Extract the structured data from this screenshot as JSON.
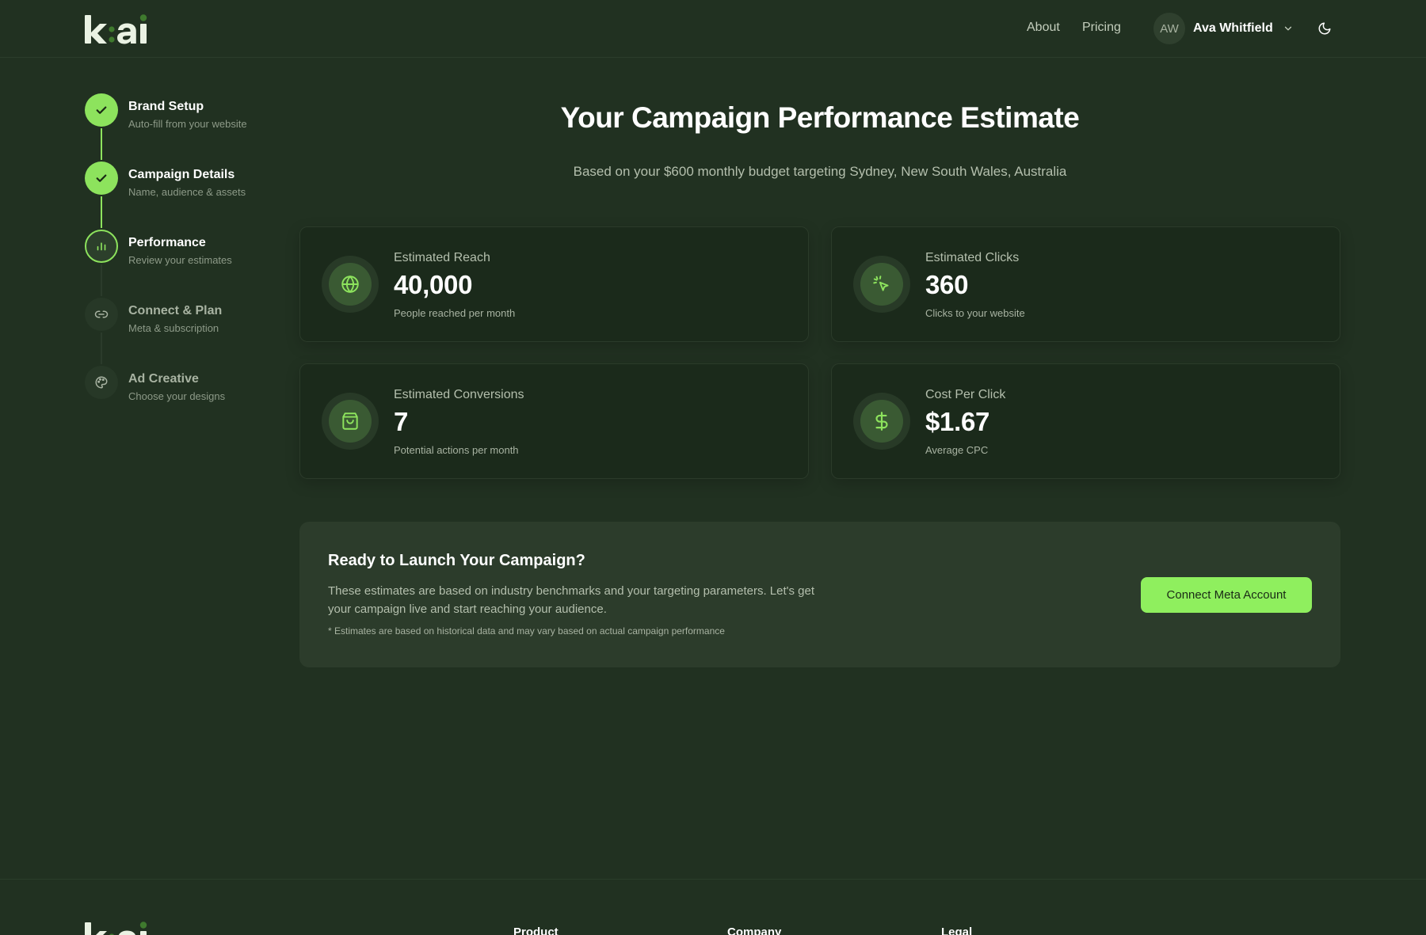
{
  "header": {
    "logo_text": "k:ai",
    "nav": [
      {
        "label": "About"
      },
      {
        "label": "Pricing"
      }
    ],
    "user": {
      "initials": "AW",
      "name": "Ava Whitfield"
    }
  },
  "stepper": {
    "steps": [
      {
        "title": "Brand Setup",
        "subtitle": "Auto-fill from your website",
        "status": "done",
        "icon": "check-icon"
      },
      {
        "title": "Campaign Details",
        "subtitle": "Name, audience & assets",
        "status": "done",
        "icon": "check-icon"
      },
      {
        "title": "Performance",
        "subtitle": "Review your estimates",
        "status": "active",
        "icon": "bar-chart-icon"
      },
      {
        "title": "Connect & Plan",
        "subtitle": "Meta & subscription",
        "status": "pending",
        "icon": "link-icon"
      },
      {
        "title": "Ad Creative",
        "subtitle": "Choose your designs",
        "status": "pending",
        "icon": "palette-icon"
      }
    ]
  },
  "main": {
    "title": "Your Campaign Performance Estimate",
    "subtitle": "Based on your $600 monthly budget targeting Sydney, New South Wales, Australia",
    "metrics": [
      {
        "label": "Estimated Reach",
        "value": "40,000",
        "desc": "People reached per month",
        "icon": "globe-icon"
      },
      {
        "label": "Estimated Clicks",
        "value": "360",
        "desc": "Clicks to your website",
        "icon": "cursor-click-icon"
      },
      {
        "label": "Estimated Conversions",
        "value": "7",
        "desc": "Potential actions per month",
        "icon": "shopping-bag-icon"
      },
      {
        "label": "Cost Per Click",
        "value": "$1.67",
        "desc": "Average CPC",
        "icon": "dollar-icon"
      }
    ],
    "cta": {
      "title": "Ready to Launch Your Campaign?",
      "text": "These estimates are based on industry benchmarks and your targeting parameters. Let's get your campaign live and start reaching your audience.",
      "note": "* Estimates are based on historical data and may vary based on actual campaign performance",
      "button": "Connect Meta Account"
    }
  },
  "footer": {
    "columns": [
      {
        "heading": "Product"
      },
      {
        "heading": "Company"
      },
      {
        "heading": "Legal"
      }
    ]
  },
  "colors": {
    "background": "#213121",
    "accent": "#8de35d",
    "card": "#1b2a1b",
    "cta_panel": "#2c3c2b"
  }
}
